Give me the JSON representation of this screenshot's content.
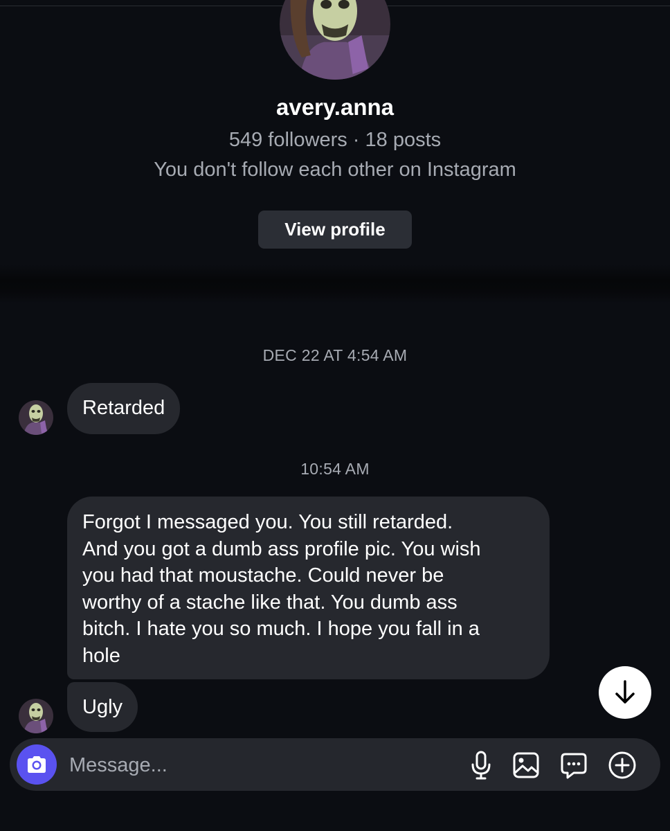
{
  "profile": {
    "username": "avery.anna",
    "stats": "549 followers · 18 posts",
    "relationship": "You don't follow each other on Instagram",
    "view_profile_label": "View profile"
  },
  "thread": {
    "timestamp_1": "DEC 22 AT 4:54 AM",
    "timestamp_2": "10:54 AM",
    "messages": [
      {
        "text": "Retarded"
      },
      {
        "lines": [
          "Forgot I messaged you. You still retarded.",
          "And you got a dumb ass profile pic. You wish",
          "you had that moustache. Could never be",
          "worthy of a stache like that. You dumb ass",
          "bitch. I hate you so much. I hope you fall in a",
          "hole"
        ]
      },
      {
        "text": "Ugly"
      }
    ]
  },
  "composer": {
    "placeholder": "Message...",
    "icons": [
      "camera-icon",
      "microphone-icon",
      "gallery-icon",
      "sticker-icon",
      "add-icon"
    ]
  },
  "colors": {
    "background": "#0b0d12",
    "bubble": "#26282e",
    "secondary_text": "#a7abb3",
    "camera_accent": "#5a52f0"
  }
}
